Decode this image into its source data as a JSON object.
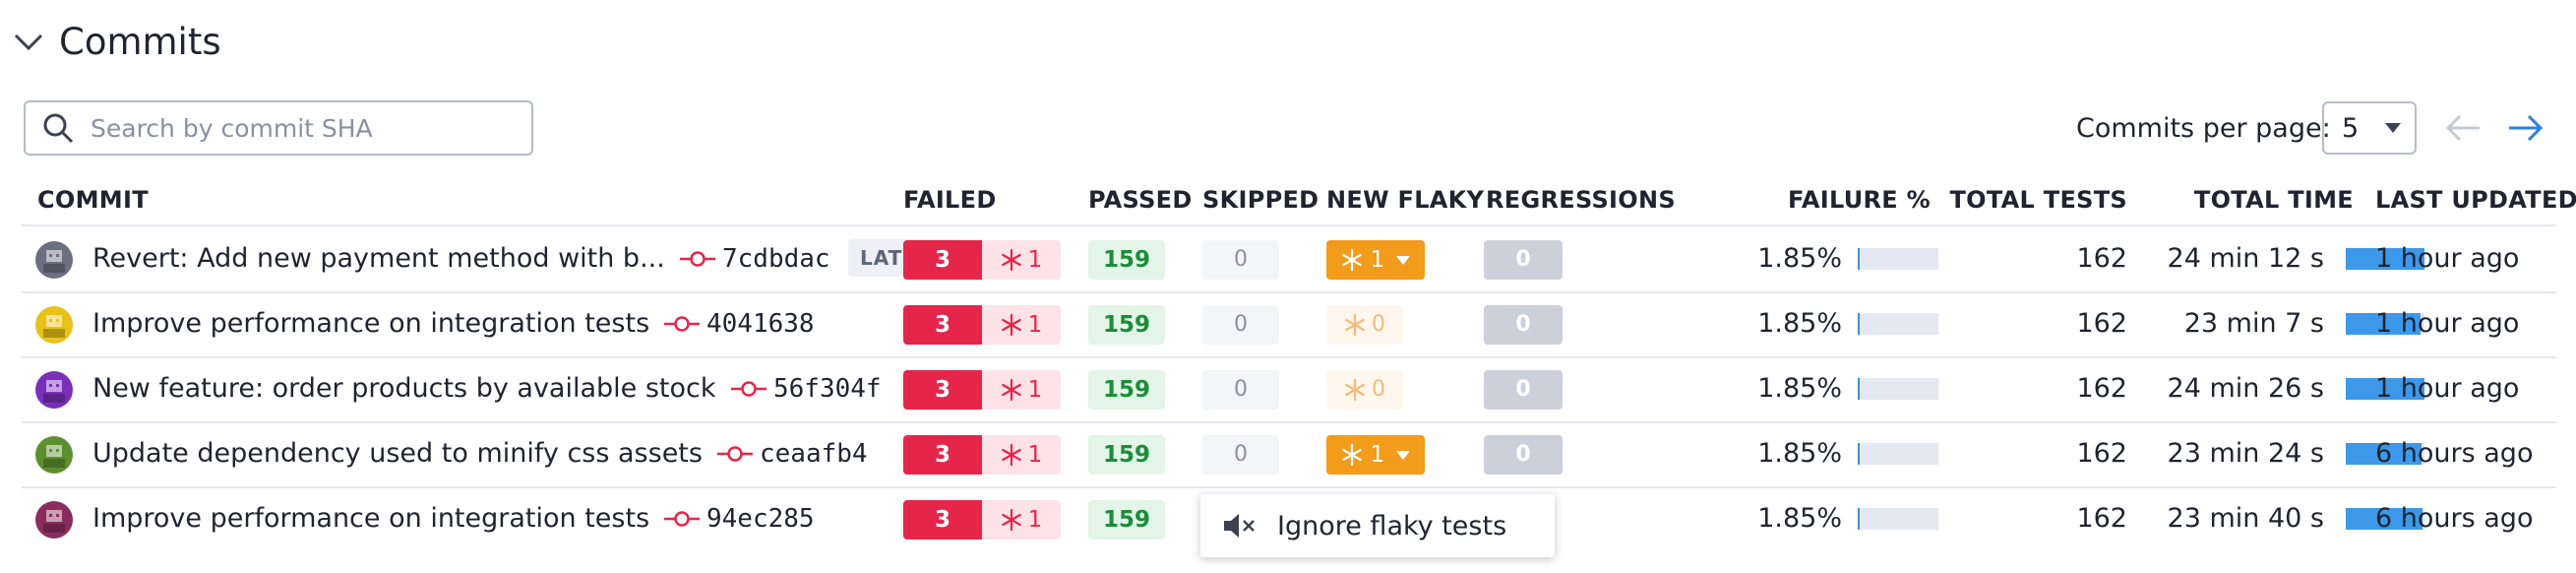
{
  "section": {
    "title": "Commits"
  },
  "search": {
    "placeholder": "Search by commit SHA",
    "value": ""
  },
  "pagination": {
    "per_page_label": "Commits per page:",
    "per_page_value": "5"
  },
  "columns": {
    "commit": "COMMIT",
    "failed": "FAILED",
    "passed": "PASSED",
    "skipped": "SKIPPED",
    "new_flaky": "NEW FLAKY",
    "regressions": "REGRESSIONS",
    "failure_pct": "FAILURE %",
    "total_tests": "TOTAL TESTS",
    "total_time": "TOTAL TIME",
    "last_updated": "LAST UPDATED"
  },
  "rows": [
    {
      "message": "Revert: Add new payment method with b...",
      "sha": "7cdbdac",
      "badge": "LATEST",
      "failed": "3",
      "failed_flaky": "1",
      "passed": "159",
      "skipped": "0",
      "new_flaky": "1",
      "new_flaky_active": true,
      "regressions": "0",
      "failure_pct": "1.85%",
      "failure_fraction": 0.0185,
      "total_tests": "162",
      "total_time": "24 min 12 s",
      "time_fraction": 1.0,
      "last_updated": "1 hour ago",
      "avatar_color": "#6b6f80"
    },
    {
      "message": "Improve performance on integration tests",
      "sha": "4041638",
      "badge": "",
      "failed": "3",
      "failed_flaky": "1",
      "passed": "159",
      "skipped": "0",
      "new_flaky": "0",
      "new_flaky_active": false,
      "regressions": "0",
      "failure_pct": "1.85%",
      "failure_fraction": 0.0185,
      "total_tests": "162",
      "total_time": "23 min 7 s",
      "time_fraction": 0.95,
      "last_updated": "1 hour ago",
      "avatar_color": "#e8c21a"
    },
    {
      "message": "New feature: order products by available stock",
      "sha": "56f304f",
      "badge": "",
      "failed": "3",
      "failed_flaky": "1",
      "passed": "159",
      "skipped": "0",
      "new_flaky": "0",
      "new_flaky_active": false,
      "regressions": "0",
      "failure_pct": "1.85%",
      "failure_fraction": 0.0185,
      "total_tests": "162",
      "total_time": "24 min 26 s",
      "time_fraction": 1.0,
      "last_updated": "1 hour ago",
      "avatar_color": "#7a2fb8"
    },
    {
      "message": "Update dependency used to minify css assets",
      "sha": "ceaafb4",
      "badge": "",
      "failed": "3",
      "failed_flaky": "1",
      "passed": "159",
      "skipped": "0",
      "new_flaky": "1",
      "new_flaky_active": true,
      "regressions": "0",
      "failure_pct": "1.85%",
      "failure_fraction": 0.0185,
      "total_tests": "162",
      "total_time": "23 min 24 s",
      "time_fraction": 0.96,
      "last_updated": "6 hours ago",
      "avatar_color": "#5e8f2e"
    },
    {
      "message": "Improve performance on integration tests",
      "sha": "94ec285",
      "badge": "",
      "failed": "3",
      "failed_flaky": "1",
      "passed": "159",
      "skipped": "",
      "new_flaky": "",
      "new_flaky_active": null,
      "regressions": "",
      "failure_pct": "1.85%",
      "failure_fraction": 0.0185,
      "total_tests": "162",
      "total_time": "23 min 40 s",
      "time_fraction": 0.98,
      "last_updated": "6 hours ago",
      "avatar_color": "#8a2c5e"
    }
  ],
  "popup": {
    "label": "Ignore flaky tests",
    "icon": "mute-icon"
  },
  "colors": {
    "failed": "#e5264a",
    "passed": "#1d8c3a",
    "flaky": "#f39b1b",
    "bar": "#3d8fe3"
  }
}
